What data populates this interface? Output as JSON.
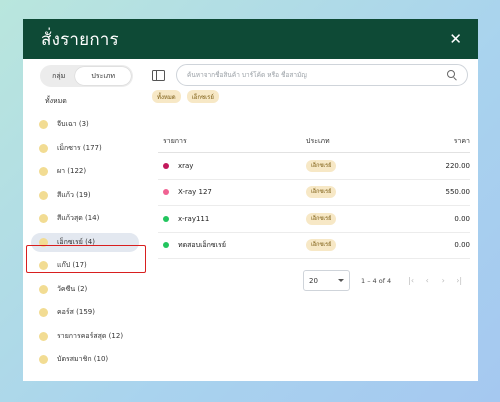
{
  "modal": {
    "title": "สั่งรายการ",
    "close_glyph": "✕"
  },
  "sidebar": {
    "segments": [
      {
        "label": "กลุ่ม",
        "active": false
      },
      {
        "label": "ประเภท",
        "active": true
      }
    ],
    "section_label": "ทั้งหมด",
    "categories": [
      {
        "label": "จีบเฉา (3)"
      },
      {
        "label": "เม็กซาร (177)"
      },
      {
        "label": "ผา (122)"
      },
      {
        "label": "สีแก้ว (19)"
      },
      {
        "label": "สีแก้วสุด (14)"
      },
      {
        "label": "เอ็กซเรย์ (4)",
        "selected": true
      },
      {
        "label": "แก๊ป (17)"
      },
      {
        "label": "วัคซีน (2)"
      },
      {
        "label": "คอร์ส (159)"
      },
      {
        "label": "รายการคอร์สสุด (12)"
      },
      {
        "label": "บัตรสมาชิก (10)"
      }
    ]
  },
  "search": {
    "placeholder": "ค้นหาจากชื่อสินค้า บาร์โค้ด หรือ ชื่อสามัญ"
  },
  "filter_chips": [
    "ทั้งหมด",
    "เอ็กซเรย์"
  ],
  "table": {
    "headers": {
      "name": "รายการ",
      "type": "ประเภท",
      "price": "ราคา"
    },
    "rows": [
      {
        "name": "xray",
        "type": "เอ็กซเรย์",
        "price": "220.00",
        "dot_color": "#c2185b"
      },
      {
        "name": "X-ray 127",
        "type": "เอ็กซเรย์",
        "price": "550.00",
        "dot_color": "#f06292"
      },
      {
        "name": "x-ray111",
        "type": "เอ็กซเรย์",
        "price": "0.00",
        "dot_color": "#22c55e"
      },
      {
        "name": "ทดสอบเอ็กซเรย์",
        "type": "เอ็กซเรย์",
        "price": "0.00",
        "dot_color": "#22c55e"
      }
    ]
  },
  "pagination": {
    "page_size": "20",
    "range": "1 – 4 of 4",
    "first_glyph": "|‹",
    "prev_glyph": "‹",
    "next_glyph": "›",
    "last_glyph": "›|"
  },
  "colors": {
    "header": "#0e4a36",
    "chip_bg": "#f7e8c6",
    "category_dot": "#f2dc93",
    "selected_pill": "#e3e8f0",
    "highlight_border": "#d81f1f"
  }
}
